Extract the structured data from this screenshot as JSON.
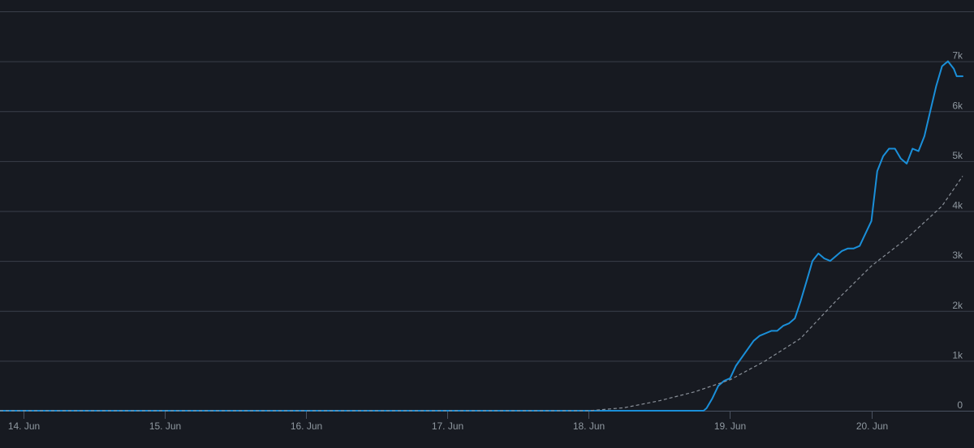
{
  "chart_data": {
    "type": "line",
    "title": "",
    "xlabel": "",
    "ylabel": "",
    "grid": true,
    "ylim": [
      0,
      8000
    ],
    "yticks": [
      {
        "value": 0,
        "label": "0"
      },
      {
        "value": 1000,
        "label": "1k"
      },
      {
        "value": 2000,
        "label": "2k"
      },
      {
        "value": 3000,
        "label": "3k"
      },
      {
        "value": 4000,
        "label": "4k"
      },
      {
        "value": 5000,
        "label": "5k"
      },
      {
        "value": 6000,
        "label": "6k"
      },
      {
        "value": 7000,
        "label": "7k"
      }
    ],
    "xlim": [
      "13 Jun 20:00",
      "20 Jun 15:30"
    ],
    "xticks": [
      "14. Jun",
      "15. Jun",
      "16. Jun",
      "17. Jun",
      "18. Jun",
      "19. Jun",
      "20. Jun"
    ],
    "colors": {
      "background": "#171a21",
      "grid": "#3a3f4a",
      "series_main": "#1a8fd9",
      "series_trend": "#8a9099",
      "tick_text": "#8f98a0"
    },
    "series": [
      {
        "style": "solid",
        "x": [
          "13 Jun 20:00",
          "18 Jun 00:00",
          "18 Jun 19:30",
          "18 Jun 20:00",
          "18 Jun 21:00",
          "18 Jun 22:00",
          "18 Jun 23:00",
          "19 Jun 00:00",
          "19 Jun 01:00",
          "19 Jun 02:30",
          "19 Jun 04:00",
          "19 Jun 05:00",
          "19 Jun 06:00",
          "19 Jun 07:00",
          "19 Jun 08:00",
          "19 Jun 09:00",
          "19 Jun 10:00",
          "19 Jun 11:00",
          "19 Jun 12:00",
          "19 Jun 13:00",
          "19 Jun 14:00",
          "19 Jun 15:00",
          "19 Jun 16:00",
          "19 Jun 17:00",
          "19 Jun 18:00",
          "19 Jun 19:00",
          "19 Jun 20:00",
          "19 Jun 21:00",
          "19 Jun 22:00",
          "20 Jun 00:00",
          "20 Jun 01:00",
          "20 Jun 02:00",
          "20 Jun 03:00",
          "20 Jun 04:00",
          "20 Jun 05:00",
          "20 Jun 06:00",
          "20 Jun 07:00",
          "20 Jun 08:00",
          "20 Jun 09:00",
          "20 Jun 10:00",
          "20 Jun 11:00",
          "20 Jun 12:00",
          "20 Jun 13:00",
          "20 Jun 14:00",
          "20 Jun 14:30",
          "20 Jun 15:00",
          "20 Jun 15:30"
        ],
        "y": [
          0,
          0,
          0,
          50,
          250,
          500,
          600,
          650,
          900,
          1150,
          1400,
          1500,
          1550,
          1600,
          1600,
          1700,
          1750,
          1850,
          2200,
          2600,
          3000,
          3150,
          3050,
          3000,
          3100,
          3200,
          3250,
          3250,
          3300,
          3800,
          4800,
          5100,
          5250,
          5250,
          5050,
          4950,
          5250,
          5200,
          5500,
          6000,
          6500,
          6900,
          7000,
          6850,
          6700,
          6700,
          6700
        ]
      },
      {
        "style": "dashed",
        "x": [
          "13 Jun 20:00",
          "18 Jun 00:00",
          "18 Jun 06:00",
          "18 Jun 12:00",
          "18 Jun 18:00",
          "19 Jun 00:00",
          "19 Jun 06:00",
          "19 Jun 12:00",
          "19 Jun 18:00",
          "20 Jun 00:00",
          "20 Jun 06:00",
          "20 Jun 12:00",
          "20 Jun 15:30"
        ],
        "y": [
          0,
          0,
          60,
          200,
          380,
          620,
          1000,
          1450,
          2200,
          2900,
          3450,
          4100,
          4700
        ]
      }
    ]
  }
}
